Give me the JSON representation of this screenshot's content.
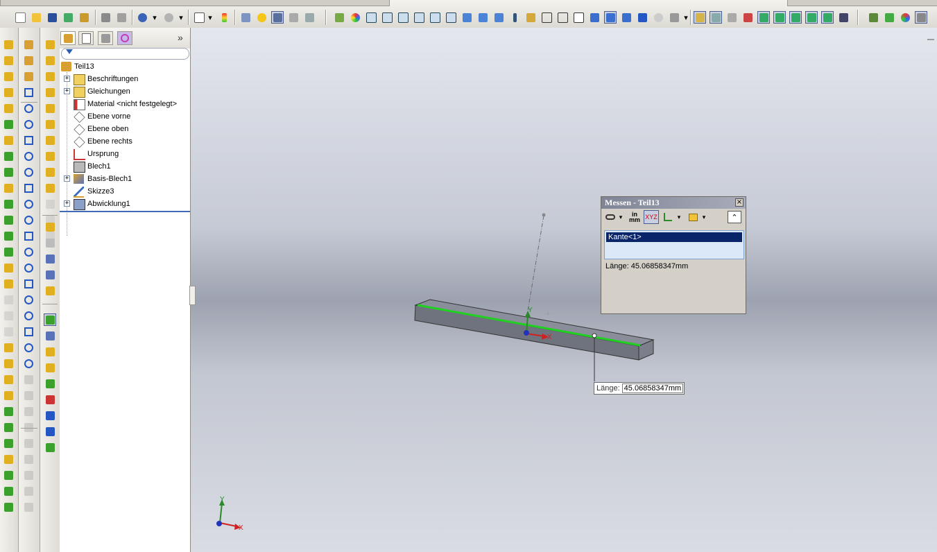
{
  "tree": {
    "root": "Teil13",
    "items": [
      {
        "label": "Beschriftungen",
        "icon": "annotations-icon",
        "expandable": true
      },
      {
        "label": "Gleichungen",
        "icon": "equations-icon",
        "expandable": true
      },
      {
        "label": "Material <nicht festgelegt>",
        "icon": "material-icon",
        "expandable": false
      },
      {
        "label": "Ebene vorne",
        "icon": "plane-icon",
        "expandable": false
      },
      {
        "label": "Ebene oben",
        "icon": "plane-icon",
        "expandable": false
      },
      {
        "label": "Ebene rechts",
        "icon": "plane-icon",
        "expandable": false
      },
      {
        "label": "Ursprung",
        "icon": "origin-icon",
        "expandable": false
      },
      {
        "label": "Blech1",
        "icon": "sheetmetal-icon",
        "expandable": false
      },
      {
        "label": "Basis-Blech1",
        "icon": "base-flange-icon",
        "expandable": true
      },
      {
        "label": "Skizze3",
        "icon": "sketch-icon",
        "expandable": false
      },
      {
        "label": "Abwicklung1",
        "icon": "flatten-icon",
        "expandable": true
      }
    ],
    "tabs": [
      "feature-manager-icon",
      "property-manager-icon",
      "configuration-manager-icon",
      "dimxpert-icon"
    ],
    "expand_glyph": "»"
  },
  "measure": {
    "title": "Messen - Teil13",
    "close": "×",
    "selection": "Kante<1>",
    "result": "Länge: 45.06858347mm",
    "units_top": "in",
    "units_bottom": "mm",
    "collapse": "⌃"
  },
  "callout": {
    "label": "Länge:",
    "value": "45.06858347mm"
  },
  "triad": {
    "x": "X",
    "y": "Y"
  },
  "colors": {
    "selected_edge": "#1fd21f",
    "title_bar": "#7f8496",
    "selection_highlight": "#0a246a",
    "active_border": "#4b5d8c"
  }
}
